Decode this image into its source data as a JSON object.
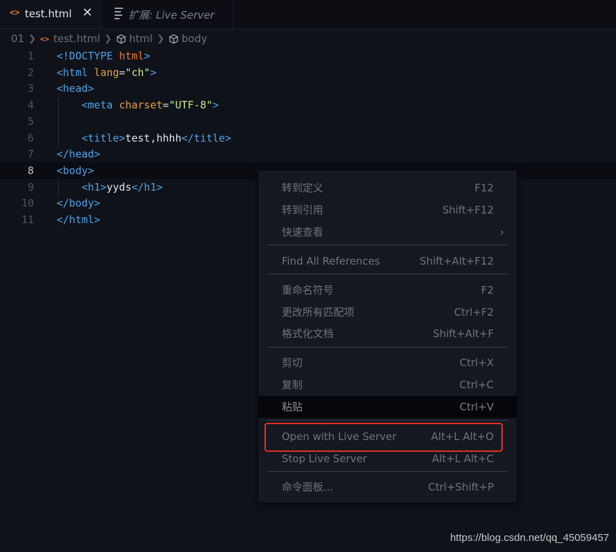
{
  "tabs": [
    {
      "icon": "html-brackets-icon",
      "glyph": "<>",
      "label": "test.html",
      "close": "✕"
    },
    {
      "icon": "preview-lines-icon",
      "label": "扩展: Live Server"
    }
  ],
  "breadcrumb": {
    "prefix": "01",
    "file": "test.html",
    "items": [
      "html",
      "body"
    ],
    "glyph": "<>"
  },
  "editor": {
    "line_numbers": [
      "1",
      "2",
      "3",
      "4",
      "5",
      "6",
      "7",
      "8",
      "9",
      "10",
      "11"
    ],
    "current_line": "8",
    "lines": [
      [
        [
          "t",
          "<!DOCTYPE "
        ],
        [
          "c",
          "html"
        ],
        [
          "t",
          ">"
        ]
      ],
      [
        [
          "t",
          "<html "
        ],
        [
          "a",
          "lang"
        ],
        [
          "p",
          "="
        ],
        [
          "s",
          "\"ch\""
        ],
        [
          "t",
          ">"
        ]
      ],
      [
        [
          "t",
          "<head>"
        ]
      ],
      [
        [
          "p",
          "    "
        ],
        [
          "t",
          "<meta "
        ],
        [
          "a",
          "charset"
        ],
        [
          "p",
          "="
        ],
        [
          "s",
          "\"UTF-8\""
        ],
        [
          "t",
          ">"
        ]
      ],
      [],
      [
        [
          "p",
          "    "
        ],
        [
          "t",
          "<title>"
        ],
        [
          "tx",
          "test,hhhh"
        ],
        [
          "t",
          "</title>"
        ]
      ],
      [
        [
          "t",
          "</head>"
        ]
      ],
      [
        [
          "t",
          "<body>"
        ]
      ],
      [
        [
          "p",
          "    "
        ],
        [
          "t",
          "<h1>"
        ],
        [
          "tx",
          "yyds"
        ],
        [
          "t",
          "</h1>"
        ]
      ],
      [
        [
          "t",
          "</body>"
        ]
      ],
      [
        [
          "t",
          "</html>"
        ]
      ]
    ]
  },
  "context_menu": {
    "items": [
      {
        "label": "转到定义",
        "shortcut": "F12"
      },
      {
        "label": "转到引用",
        "shortcut": "Shift+F12"
      },
      {
        "label": "快速查看",
        "shortcut": "›"
      },
      {
        "label": "Find All References",
        "shortcut": "Shift+Alt+F12"
      },
      {
        "label": "重命名符号",
        "shortcut": "F2"
      },
      {
        "label": "更改所有匹配项",
        "shortcut": "Ctrl+F2"
      },
      {
        "label": "格式化文档",
        "shortcut": "Shift+Alt+F"
      },
      {
        "label": "剪切",
        "shortcut": "Ctrl+X"
      },
      {
        "label": "复制",
        "shortcut": "Ctrl+C"
      },
      {
        "label": "粘贴",
        "shortcut": "Ctrl+V"
      },
      {
        "label": "Open with Live Server",
        "shortcut": "Alt+L Alt+O"
      },
      {
        "label": "Stop Live Server",
        "shortcut": "Alt+L Alt+C"
      },
      {
        "label": "命令面板...",
        "shortcut": "Ctrl+Shift+P"
      }
    ],
    "highlighted": "粘贴"
  },
  "watermark": "https://blog.csdn.net/qq_45059457",
  "colors": {
    "background": "#10121a",
    "tag": "#4fa3e6",
    "attribute": "#e3a142",
    "string": "#c3e88d",
    "html_icon": "#e37933",
    "annotation_box": "#e5301f"
  }
}
